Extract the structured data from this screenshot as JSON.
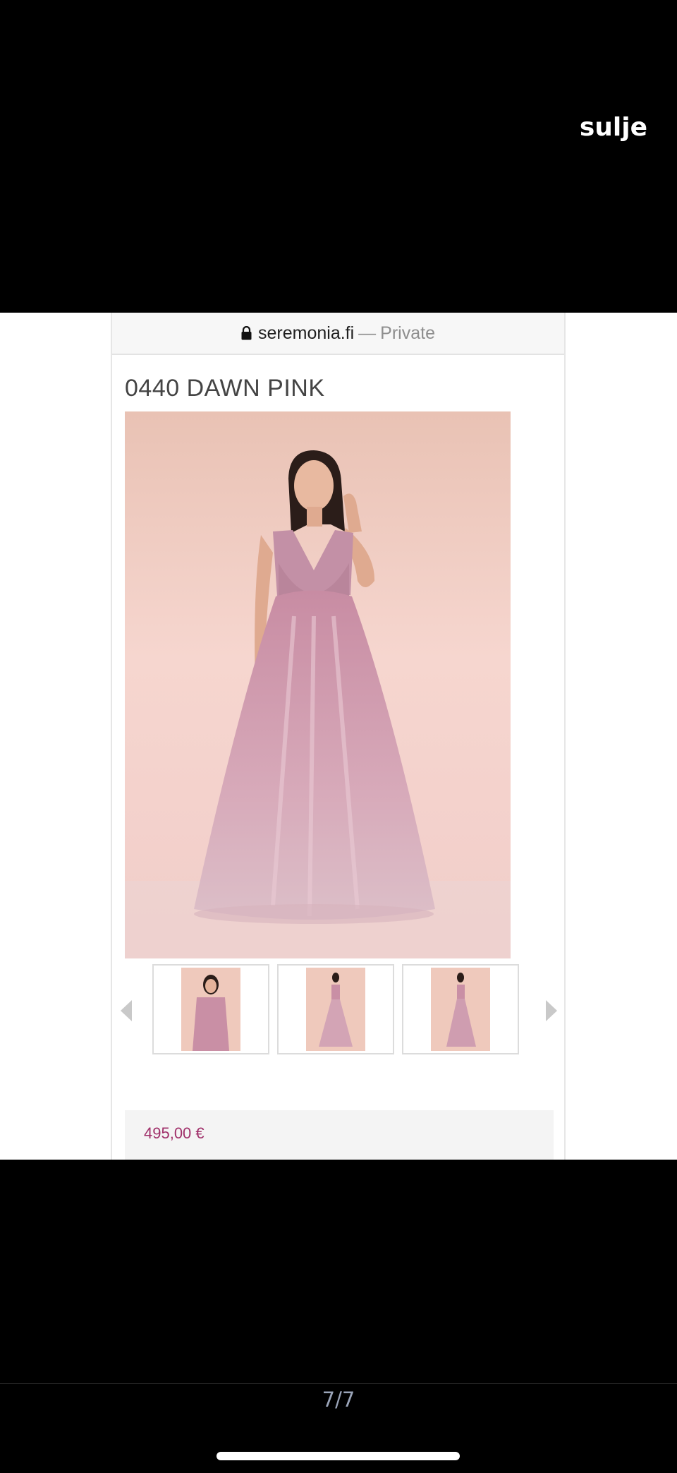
{
  "viewer": {
    "close_label": "sulje",
    "page_counter": "7/7"
  },
  "browser": {
    "domain": "seremonia.fi",
    "separator": "—",
    "mode": "Private",
    "lock_icon": "lock-icon"
  },
  "product": {
    "title": "0440 DAWN PINK",
    "price": "495,00 €",
    "thumbnails": [
      {
        "name": "front-closeup"
      },
      {
        "name": "front-full"
      },
      {
        "name": "side-full"
      }
    ]
  },
  "colors": {
    "price": "#a0306a",
    "photo_background": "#f3d2cb",
    "dress": "#c991a6"
  }
}
